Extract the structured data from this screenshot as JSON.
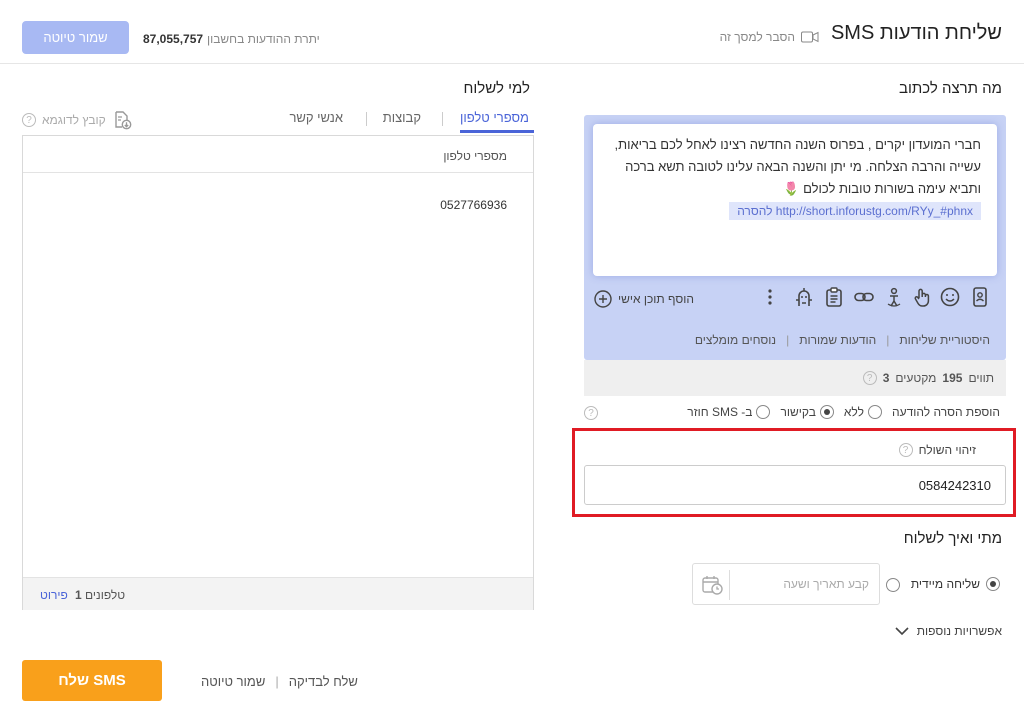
{
  "header": {
    "title": "שליחת הודעות SMS",
    "explain_link": "הסבר למסך זה",
    "save_draft_label": "שמור טיוטה",
    "balance_value": "87,055,757",
    "balance_label": "יתרת ההודעות בחשבון"
  },
  "compose": {
    "title": "מה תרצה לכתוב",
    "message_lines": [
      "חברי המועדון יקרים , בפרוס השנה החדשה רצינו לאחל לכם בריאות,",
      "עשייה והרבה הצלחה. מי יתן והשנה הבאה עלינו לטובה תשא ברכה",
      "ותביא עימה בשורות טובות לכולם 🌷"
    ],
    "link_text": "http://short.inforustg.com/RYy_#phnx להסרה",
    "add_personal_content": "הוסף תוכן אישי",
    "links": [
      "היסטוריית שליחות",
      "הודעות שמורות",
      "נוסחים מומלצים"
    ],
    "count_chars_label": "תווים",
    "count_chars": "195",
    "count_segments_label": "מקטעים",
    "count_segments": "3",
    "toolbar_icons": [
      "contact-card-icon",
      "emoji-icon",
      "touch-icon",
      "person-icon",
      "link-icon",
      "clipboard-icon",
      "robot-icon",
      "more-icon"
    ]
  },
  "removal": {
    "label": "הוספת הסרה להודעה",
    "options": [
      "ללא",
      "בקישור",
      "ב- SMS חוזר"
    ],
    "selected": "בקישור"
  },
  "sender": {
    "label": "זיהוי השולח",
    "value": "0584242310"
  },
  "when": {
    "title": "מתי ואיך לשלוח",
    "immediate_label": "שליחה מיידית",
    "schedule_placeholder": "קבע תאריך ושעה",
    "more_options": "אפשרויות נוספות"
  },
  "recipients": {
    "title": "למי לשלוח",
    "tabs": [
      "מספרי טלפון",
      "קבוצות",
      "אנשי קשר"
    ],
    "active_tab": "מספרי טלפון",
    "example_file": "קובץ לדוגמא",
    "column_header": "מספרי טלפון",
    "numbers": [
      "0527766936"
    ],
    "footer_label": "טלפונים",
    "footer_count": "1",
    "details_link": "פירוט"
  },
  "actions": {
    "send": "שלח SMS",
    "send_test": "שלח לבדיקה",
    "save_draft": "שמור טיוטה"
  },
  "colors": {
    "accent": "#4a64d8",
    "send_button": "#f9a01b",
    "compose_bg": "#c7d2f5",
    "highlight": "#e01b24"
  }
}
